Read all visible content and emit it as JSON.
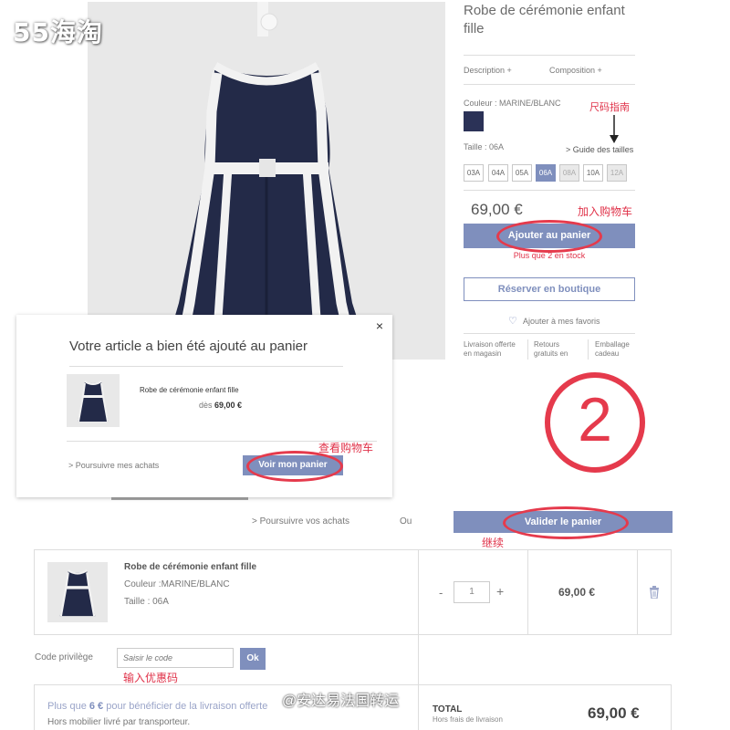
{
  "watermark": "55海淘",
  "product": {
    "title": "Robe de cérémonie enfant fille",
    "tabs": [
      {
        "label": "Description +"
      },
      {
        "label": "Composition +"
      }
    ],
    "color_label": "Couleur : MARINE/BLANC",
    "color_swatch": "#2b3257",
    "size_label": "Taille : 06A",
    "size_guide": "> Guide des tailles",
    "sizes": [
      {
        "label": "03A",
        "state": "normal"
      },
      {
        "label": "04A",
        "state": "normal"
      },
      {
        "label": "05A",
        "state": "normal"
      },
      {
        "label": "06A",
        "state": "selected"
      },
      {
        "label": "08A",
        "state": "disabled"
      },
      {
        "label": "10A",
        "state": "normal"
      },
      {
        "label": "12A",
        "state": "disabled"
      }
    ],
    "price": "69,00 €",
    "add_to_cart": "Ajouter au panier",
    "stock_note": "Plus que 2 en stock",
    "reserve": "Réserver en boutique",
    "favorite": "Ajouter à mes favoris",
    "benefits": [
      {
        "line1": "Livraison offerte",
        "line2": "en magasin"
      },
      {
        "line1": "Retours",
        "line2": "gratuits en"
      },
      {
        "line1": "Emballage",
        "line2": "cadeau"
      }
    ]
  },
  "annotations": {
    "size_guide": "尺码指南",
    "add_cart": "加入购物车",
    "view_cart": "查看购物车",
    "continue": "继续",
    "coupon": "输入优惠码",
    "step": "②"
  },
  "popup": {
    "title": "Votre article a bien été ajouté au panier",
    "item_name": "Robe de cérémonie enfant fille",
    "price_prefix": "dès",
    "price": "69,00 €",
    "continue_link": "> Poursuivre mes achats",
    "view_cart": "Voir mon panier",
    "close": "×"
  },
  "cart": {
    "continue_link": "> Poursuivre vos achats",
    "or": "Ou",
    "validate": "Valider le panier",
    "item": {
      "name": "Robe de cérémonie enfant fille",
      "color": "Couleur :MARINE/BLANC",
      "size": "Taille : 06A",
      "qty": "1",
      "minus": "-",
      "plus": "+",
      "price": "69,00 €"
    },
    "promo_label": "Code privilège",
    "promo_placeholder": "Saisir le code",
    "promo_ok": "Ok",
    "shipping_pre": "Plus que ",
    "shipping_amount": "6 €",
    "shipping_post": " pour bénéficier de la livraison offerte",
    "shipping_note": "Hors mobilier livré par transporteur.",
    "total_label": "TOTAL",
    "total_note": "Hors frais de livraison",
    "total": "69,00 €"
  },
  "credit": "@安达易法国转运",
  "colors": {
    "accent": "#7f8fbd",
    "annotation": "#e53a4c",
    "navy": "#2b3257"
  }
}
